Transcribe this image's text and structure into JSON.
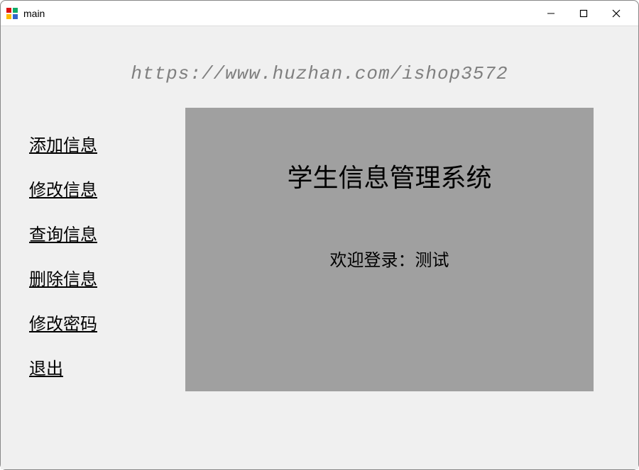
{
  "window": {
    "title": "main"
  },
  "watermark": "https://www.huzhan.com/ishop3572",
  "sidebar": {
    "items": [
      {
        "label": "添加信息"
      },
      {
        "label": "修改信息"
      },
      {
        "label": "查询信息"
      },
      {
        "label": "删除信息"
      },
      {
        "label": "修改密码"
      },
      {
        "label": "退出"
      }
    ]
  },
  "panel": {
    "title": "学生信息管理系统",
    "welcome": "欢迎登录：测试"
  }
}
